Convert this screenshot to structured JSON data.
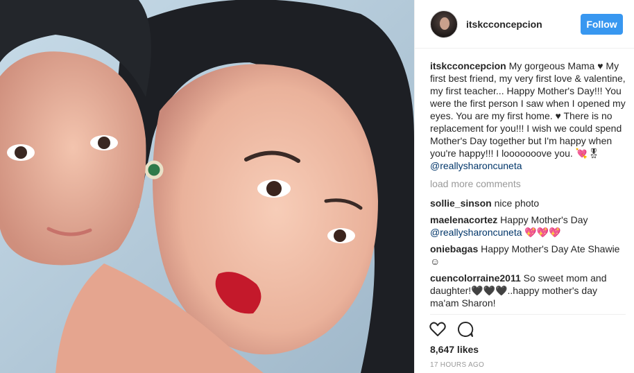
{
  "post": {
    "username": "itskcconcepcion",
    "follow_label": "Follow",
    "caption_user": "itskcconcepcion",
    "caption_text": "My gorgeous Mama ♥ My first best friend, my very first love & valentine, my first teacher... Happy Mother's Day!!! You were the first person I saw when I opened my eyes. You are my first home. ♥ There is no replacement for you!!! I wish we could spend Mother's Day together but I'm happy when you're happy!!! I looooooove you. 💘🎖",
    "caption_mention": "@reallysharoncuneta",
    "load_more": "load more comments",
    "comments": [
      {
        "user": "sollie_sinson",
        "text": "nice photo",
        "mention": ""
      },
      {
        "user": "maelenacortez",
        "text": "Happy Mother's Day",
        "mention": "@reallysharoncuneta",
        "after": "💖💖💖"
      },
      {
        "user": "oniebagas",
        "text": "Happy Mother's Day Ate Shawie ☺",
        "mention": ""
      },
      {
        "user": "cuencolorraine2011",
        "text": "So sweet mom and daughter!🖤🖤🖤..happy mother's day ma'am Sharon!",
        "mention": ""
      }
    ],
    "likes": "8,647 likes",
    "timestamp": "17 HOURS AGO",
    "icons": [
      "heart-icon",
      "comment-icon"
    ],
    "colors": {
      "follow": "#3897f0",
      "mention": "#003569",
      "muted": "#999999"
    }
  }
}
